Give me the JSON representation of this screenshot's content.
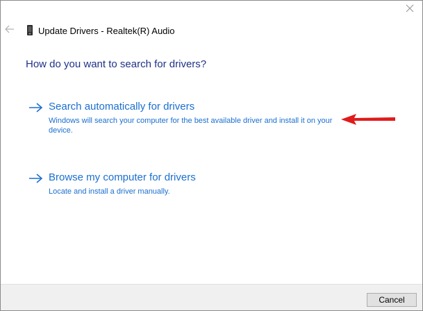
{
  "window": {
    "title": "Update Drivers - Realtek(R) Audio",
    "icons": {
      "close": "close-icon",
      "back": "back-arrow-icon",
      "title": "device-icon"
    }
  },
  "main": {
    "question": "How do you want to search for drivers?",
    "options": [
      {
        "title": "Search automatically for drivers",
        "description": "Windows will search your computer for the best available driver and install it on your device.",
        "icon": "arrow-right-icon"
      },
      {
        "title": "Browse my computer for drivers",
        "description": "Locate and install a driver manually.",
        "icon": "arrow-right-icon"
      }
    ]
  },
  "annotation": {
    "icon": "red-arrow-icon",
    "color": "#e01b1b"
  },
  "footer": {
    "cancel_label": "Cancel"
  },
  "colors": {
    "link": "#1a6fd0",
    "heading": "#1e3287",
    "footer_bg": "#f0f0f0"
  }
}
